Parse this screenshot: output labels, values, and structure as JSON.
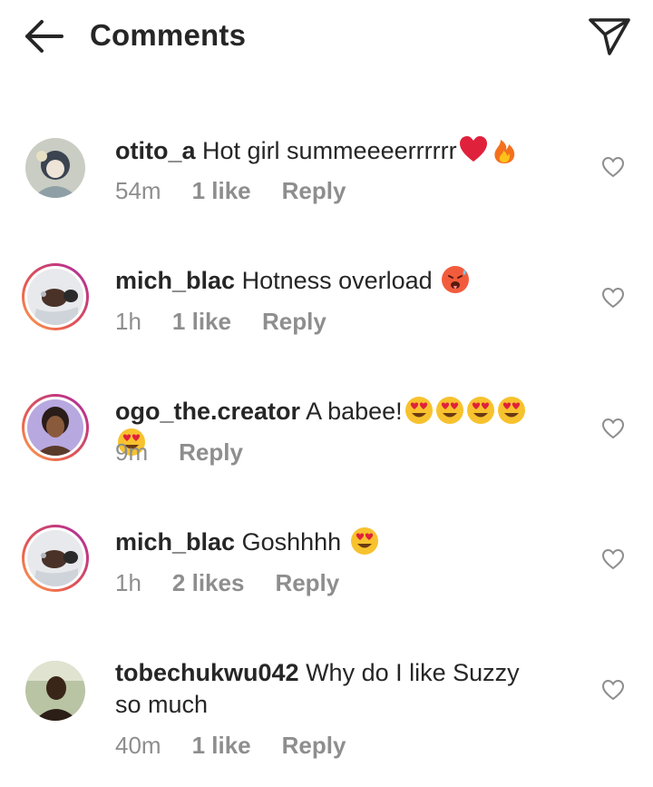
{
  "header": {
    "title": "Comments",
    "back_icon": "arrow-left-icon",
    "share_icon": "send-paper-plane-icon"
  },
  "comments": [
    {
      "username": "otito_a",
      "text": "Hot girl summeeeerrrrrr",
      "emojis": [
        "red-heart",
        "fire"
      ],
      "time": "54m",
      "likes": "1 like",
      "reply": "Reply",
      "avatar_ring": false
    },
    {
      "username": "mich_blac",
      "text": "Hotness overload",
      "emojis": [
        "hot-face"
      ],
      "time": "1h",
      "likes": "1 like",
      "reply": "Reply",
      "avatar_ring": true
    },
    {
      "username": "ogo_the.creator",
      "text": "A babee!",
      "emojis": [
        "heart-eyes",
        "heart-eyes",
        "heart-eyes",
        "heart-eyes",
        "heart-eyes"
      ],
      "time": "9m",
      "likes": "",
      "reply": "Reply",
      "avatar_ring": true
    },
    {
      "username": "mich_blac",
      "text": "Goshhhh",
      "emojis": [
        "heart-eyes"
      ],
      "time": "1h",
      "likes": "2 likes",
      "reply": "Reply",
      "avatar_ring": true
    },
    {
      "username": "tobechukwu042",
      "text": "Why do I like Suzzy so much",
      "emojis": [],
      "time": "40m",
      "likes": "1 like",
      "reply": "Reply",
      "avatar_ring": false
    }
  ],
  "colors": {
    "text": "#262626",
    "meta": "#8e8e8e",
    "emoji_yellow": "#f7c22e",
    "heart_red": "#e0213b"
  }
}
